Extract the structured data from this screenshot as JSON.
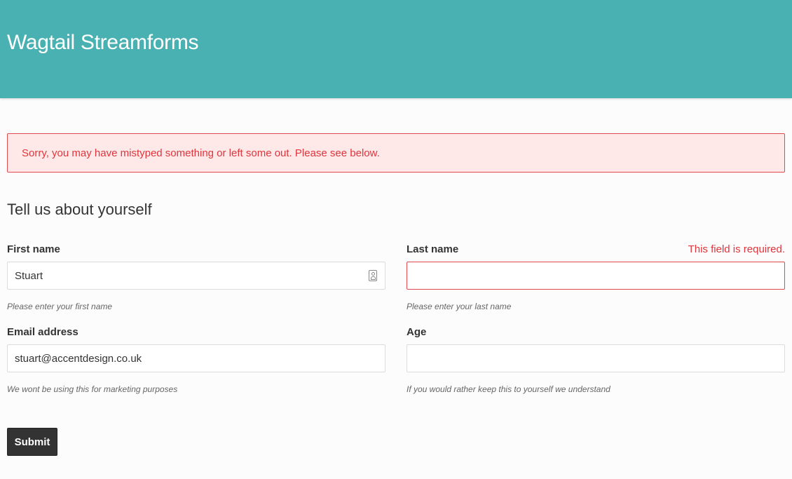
{
  "header": {
    "title": "Wagtail Streamforms"
  },
  "alert": {
    "message": "Sorry, you may have mistyped something or left some out. Please see below."
  },
  "form": {
    "heading": "Tell us about yourself",
    "fields": {
      "first_name": {
        "label": "First name",
        "value": "Stuart",
        "help": "Please enter your first name"
      },
      "last_name": {
        "label": "Last name",
        "value": "",
        "help": "Please enter your last name",
        "error": "This field is required."
      },
      "email": {
        "label": "Email address",
        "value": "stuart@accentdesign.co.uk",
        "help": "We wont be using this for marketing purposes"
      },
      "age": {
        "label": "Age",
        "value": "",
        "help": "If you would rather keep this to yourself we understand"
      }
    },
    "submit_label": "Submit"
  },
  "colors": {
    "header_bg": "#49b1b1",
    "error": "#e0353c",
    "error_bg": "#ffe8e8",
    "button_bg": "#333333"
  },
  "icons": {
    "first_name_field": "contact-card-icon"
  }
}
